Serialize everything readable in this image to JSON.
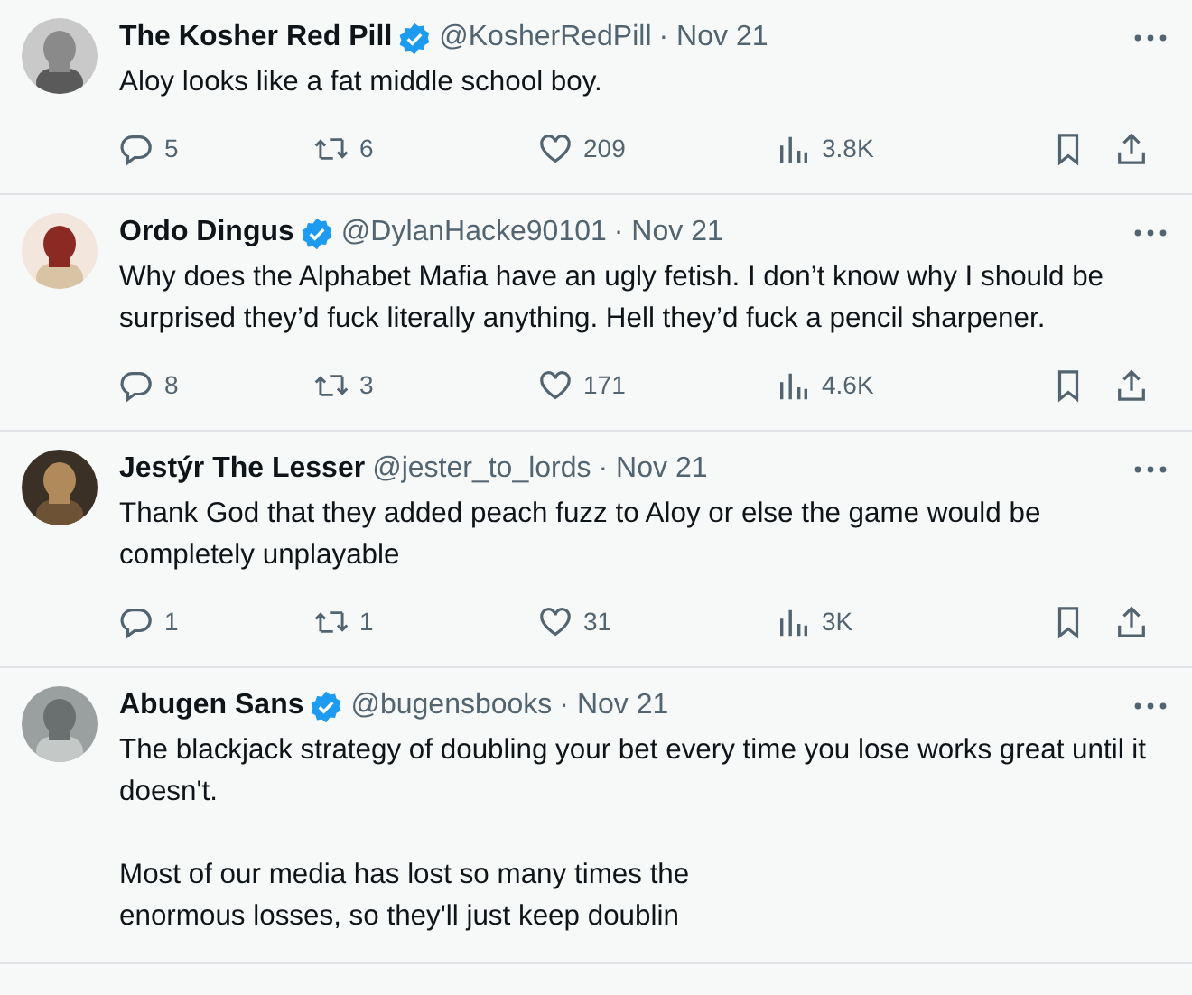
{
  "tweets": [
    {
      "name": "The Kosher Red Pill",
      "verified": true,
      "handle": "@KosherRedPill",
      "time": "· Nov 21",
      "text": "Aloy looks like a fat middle school boy.",
      "replies": "5",
      "reposts": "6",
      "likes": "209",
      "views": "3.8K"
    },
    {
      "name": "Ordo Dingus",
      "verified": true,
      "handle": "@DylanHacke90101",
      "time": "· Nov 21",
      "text": "Why does the Alphabet Mafia have an ugly fetish. I don’t know why I should be surprised they’d fuck literally anything. Hell they’d fuck a pencil sharpener.",
      "replies": "8",
      "reposts": "3",
      "likes": "171",
      "views": "4.6K"
    },
    {
      "name": "Jestýr The Lesser",
      "verified": false,
      "handle": "@jester_to_lords",
      "time": "· Nov 21",
      "text": "Thank God that they added peach fuzz to Aloy or else the game would be completely unplayable",
      "replies": "1",
      "reposts": "1",
      "likes": "31",
      "views": "3K"
    },
    {
      "name": "Abugen Sans",
      "verified": true,
      "handle": "@bugensbooks",
      "time": "· Nov 21",
      "text": "The blackjack strategy of doubling your bet every time you lose works great until it doesn't.\n\nMost of our media has lost so many times the\nenormous losses, so they'll just keep doublin"
    }
  ]
}
